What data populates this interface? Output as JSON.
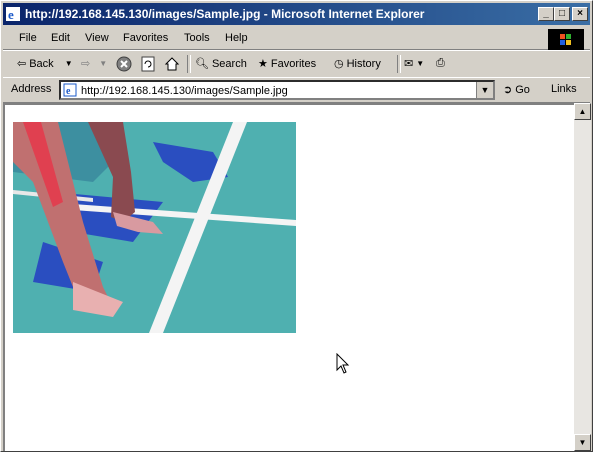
{
  "window": {
    "title": "http://192.168.145.130/images/Sample.jpg - Microsoft Internet Explorer",
    "controls": {
      "minimize": "_",
      "maximize": "□",
      "close": "×"
    }
  },
  "menu": {
    "items": [
      "File",
      "Edit",
      "View",
      "Favorites",
      "Tools",
      "Help"
    ]
  },
  "toolbar": {
    "back": "Back",
    "search": "Search",
    "favorites": "Favorites",
    "history": "History"
  },
  "address": {
    "label": "Address",
    "url": "http://192.168.145.130/images/Sample.jpg",
    "go": "Go",
    "links": "Links"
  },
  "colors": {
    "title_start": "#0a246a",
    "title_end": "#3a6ea5",
    "chrome": "#d4d0c8"
  }
}
